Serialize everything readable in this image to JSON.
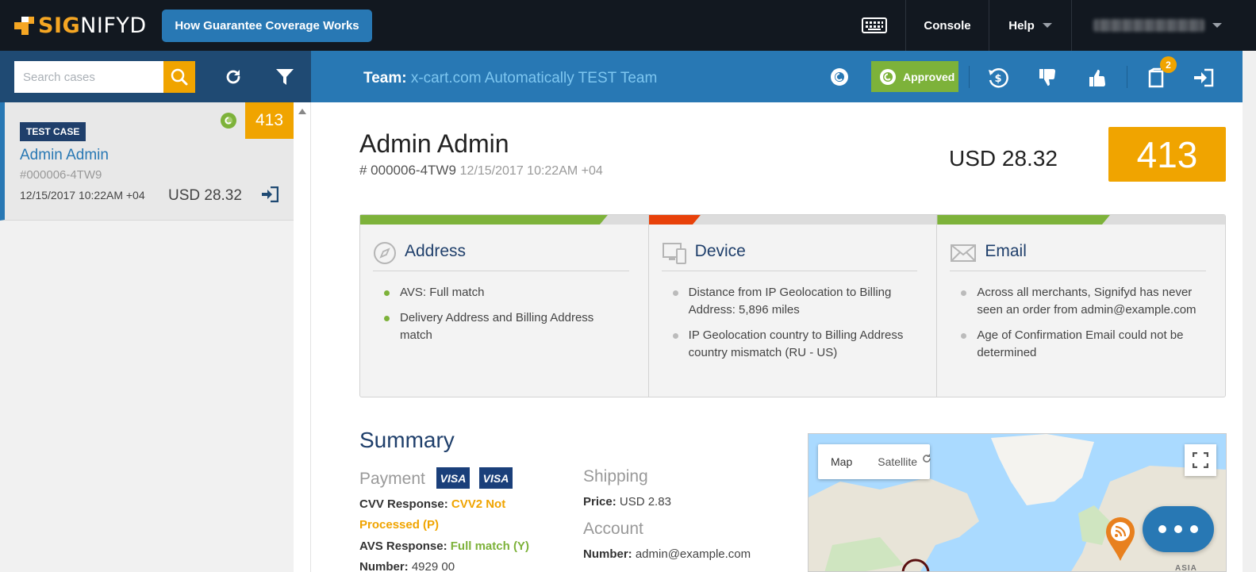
{
  "app": {
    "logo_text_1": "SIG",
    "logo_text_2": "NIFYD",
    "how_button_label": "How Guarantee Coverage Works"
  },
  "topnav": {
    "console_label": "Console",
    "help_label": "Help"
  },
  "search": {
    "placeholder": "Search cases"
  },
  "team": {
    "label": "Team:",
    "name": "x-cart.com Automatically TEST Team"
  },
  "actions": {
    "approved_label": "Approved",
    "inbox_count": "2"
  },
  "case_list": [
    {
      "tag": "TEST CASE",
      "name": "Admin Admin",
      "number": "#000006-4TW9",
      "date": "12/15/2017 10:22AM +04",
      "amount": "USD 28.32",
      "score": "413"
    }
  ],
  "case": {
    "customer_name": "Admin Admin",
    "order_number": "# 000006-4TW9",
    "order_date": "12/15/2017 10:22AM +04",
    "total": "USD 28.32",
    "score": "413"
  },
  "signals": {
    "address": {
      "title": "Address",
      "bar_fill_fraction": 0.86,
      "color": "#7db23a",
      "items": [
        "AVS: Full match",
        "Delivery Address and Billing Address match"
      ]
    },
    "device": {
      "title": "Device",
      "bar_fill_fraction": 0.18,
      "color": "#e8410a",
      "items": [
        "Distance from IP Geolocation to Billing Address: 5,896 miles",
        "IP Geolocation country to Billing Address country mismatch (RU - US)"
      ]
    },
    "email": {
      "title": "Email",
      "bar_fill_fraction": 0.6,
      "color": "#7db23a",
      "items": [
        "Across all merchants, Signifyd has never seen an order from admin@example.com",
        "Age of Confirmation Email could not be determined"
      ]
    }
  },
  "summary": {
    "title": "Summary",
    "payment": {
      "title": "Payment",
      "card_brand": "VISA",
      "cvv_label": "CVV Response:",
      "cvv_value": "CVV2 Not Processed (P)",
      "avs_label": "AVS Response:",
      "avs_value": "Full match (Y)",
      "number_label": "Number:",
      "number_value": "4929 00"
    },
    "shipping": {
      "title": "Shipping",
      "price_label": "Price:",
      "price_value": "USD 2.83"
    },
    "account": {
      "title": "Account",
      "number_label": "Number:",
      "number_value": "admin@example.com"
    }
  },
  "map": {
    "tab_map": "Map",
    "tab_satellite": "Satellite",
    "label_asia": "ASIA"
  },
  "colors": {
    "brand_orange": "#f0a400",
    "brand_blue": "#2878b4",
    "navy": "#1f3f6b",
    "green": "#7db23a",
    "red": "#e8410a"
  }
}
